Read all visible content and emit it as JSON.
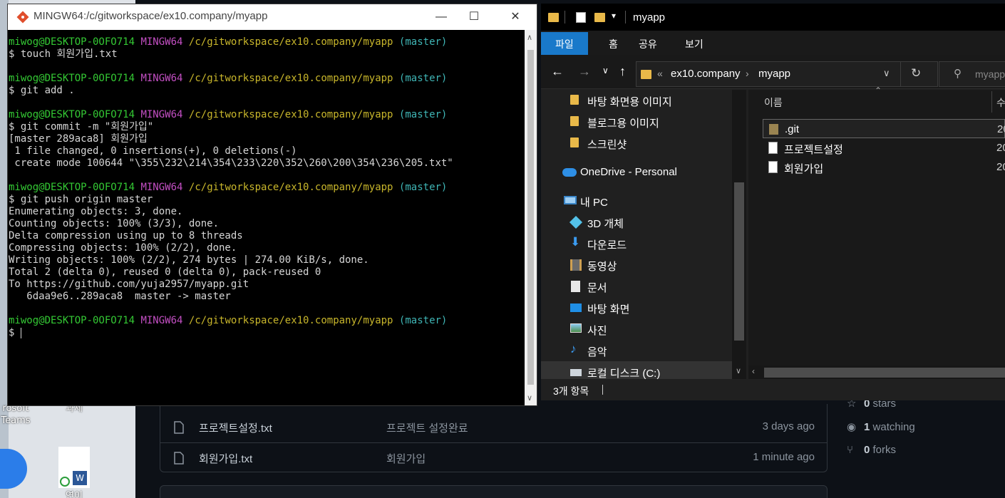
{
  "desktop": {
    "icons": [
      {
        "label": "rosoft\nTeams",
        "name": "teams-desktop-icon"
      },
      {
        "label": "과제",
        "name": "folder-desktop-icon"
      },
      {
        "label": "연이",
        "name": "word-desktop-icon"
      }
    ]
  },
  "github": {
    "files": [
      {
        "name": "프로젝트설정.txt",
        "message": "프로젝트 설정완료",
        "time": "3 days ago"
      },
      {
        "name": "회원가입.txt",
        "message": "회원가입",
        "time": "1 minute ago"
      }
    ],
    "stats": {
      "stars_count": "0",
      "stars_label": "stars",
      "watching_count": "1",
      "watching_label": "watching",
      "forks_count": "0",
      "forks_label": "forks"
    }
  },
  "terminal": {
    "title": "MINGW64:/c/gitworkspace/ex10.company/myapp",
    "user": "miwog@DESKTOP-0OFO714",
    "env": "MINGW64",
    "path": "/c/gitworkspace/ex10.company/myapp",
    "branch": "(master)",
    "cmd1": "$ touch 회원가입.txt",
    "cmd2": "$ git add .",
    "cmd3": "$ git commit -m \"회원가입\"",
    "out3": [
      "[master 289aca8] 회원가입",
      " 1 file changed, 0 insertions(+), 0 deletions(-)",
      " create mode 100644 \"\\355\\232\\214\\354\\233\\220\\352\\260\\200\\354\\236\\205.txt\""
    ],
    "cmd4": "$ git push origin master",
    "out4": [
      "Enumerating objects: 3, done.",
      "Counting objects: 100% (3/3), done.",
      "Delta compression using up to 8 threads",
      "Compressing objects: 100% (2/2), done.",
      "Writing objects: 100% (2/2), 274 bytes | 274.00 KiB/s, done.",
      "Total 2 (delta 0), reused 0 (delta 0), pack-reused 0",
      "To https://github.com/yuja2957/myapp.git",
      "   6daa9e6..289aca8  master -> master"
    ],
    "prompt": "$ "
  },
  "explorer": {
    "title": "myapp",
    "ribbon": {
      "file": "파일",
      "home": "홈",
      "share": "공유",
      "view": "보기"
    },
    "breadcrumb": {
      "prefix": "«",
      "parent": "ex10.company",
      "current": "myapp"
    },
    "search_placeholder": "myapp",
    "nav": [
      {
        "label": "바탕 화면용 이미지",
        "icon": "folder"
      },
      {
        "label": "블로그용 이미지",
        "icon": "folder"
      },
      {
        "label": "스크린샷",
        "icon": "folder"
      },
      {
        "label": "OneDrive - Personal",
        "icon": "cloud"
      },
      {
        "label": "내 PC",
        "icon": "pc"
      },
      {
        "label": "3D 개체",
        "icon": "cube"
      },
      {
        "label": "다운로드",
        "icon": "download"
      },
      {
        "label": "동영상",
        "icon": "video"
      },
      {
        "label": "문서",
        "icon": "document"
      },
      {
        "label": "바탕 화면",
        "icon": "desktop"
      },
      {
        "label": "사진",
        "icon": "pictures"
      },
      {
        "label": "음악",
        "icon": "music"
      },
      {
        "label": "로컬 디스크 (C:)",
        "icon": "drive"
      }
    ],
    "column_name": "이름",
    "column_date": "수",
    "files": [
      {
        "name": ".git",
        "date": "20"
      },
      {
        "name": "프로젝트설정",
        "date": "20"
      },
      {
        "name": "회원가입",
        "date": "20"
      }
    ],
    "status": "3개 항목"
  }
}
